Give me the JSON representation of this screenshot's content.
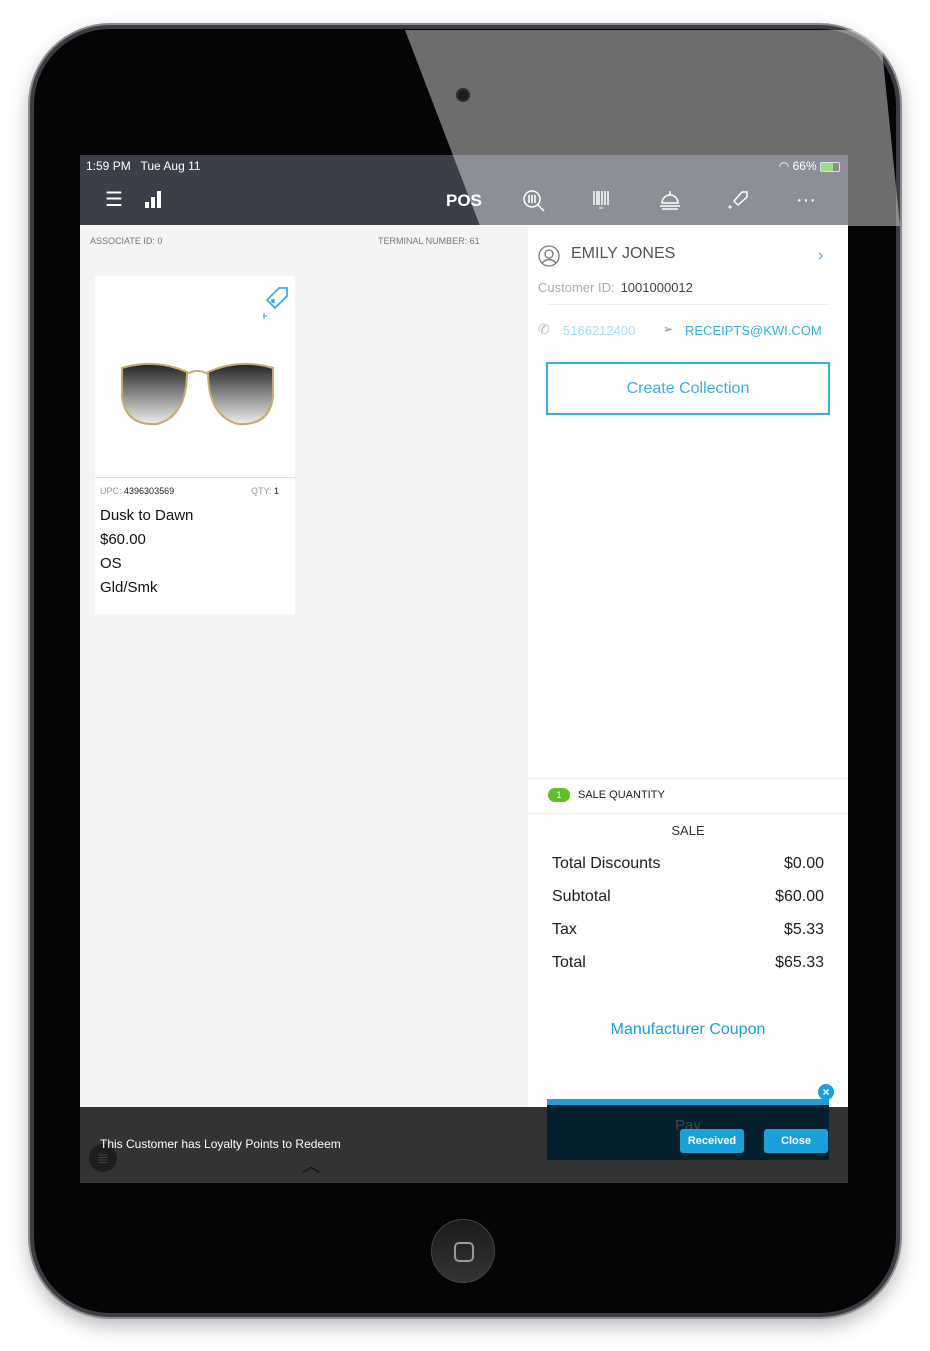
{
  "status": {
    "time": "1:59 PM",
    "date": "Tue Aug 11",
    "battery": "66%"
  },
  "header": {
    "title": "POS",
    "icons": [
      "menu-icon",
      "signal-bars-icon",
      "product-search-icon",
      "barcode-icon",
      "service-bell-icon",
      "add-tag-icon",
      "more-icon"
    ]
  },
  "info": {
    "associate": "ASSOCIATE ID: 0",
    "terminal": "TERMINAL NUMBER: 61"
  },
  "item": {
    "upc_label": "UPC:",
    "upc": "4396303569",
    "qty_label": "QTY:",
    "qty": "1",
    "name": "Dusk to Dawn",
    "price": "$60.00",
    "size": "OS",
    "color": "Gld/Smk"
  },
  "customer": {
    "name": "EMILY JONES",
    "id_label": "Customer ID:",
    "id": "1001000012",
    "phone": "5166212400",
    "email": "RECEIPTS@KWI.COM",
    "create_collection": "Create Collection"
  },
  "summary": {
    "count": "1",
    "quantity_label": "SALE QUANTITY",
    "type": "SALE",
    "rows": [
      {
        "label": "Total Discounts",
        "value": "$0.00"
      },
      {
        "label": "Subtotal",
        "value": "$60.00"
      },
      {
        "label": "Tax",
        "value": "$5.33"
      },
      {
        "label": "Total",
        "value": "$65.33"
      }
    ],
    "coupon": "Manufacturer Coupon",
    "pay": "Pay"
  },
  "toast": {
    "message": "This Customer has Loyalty Points to Redeem",
    "received": "Received",
    "close": "Close"
  },
  "colors": {
    "accent": "#1aa0dc",
    "header": "#3a3f4a",
    "badge": "#5cbf2a"
  }
}
